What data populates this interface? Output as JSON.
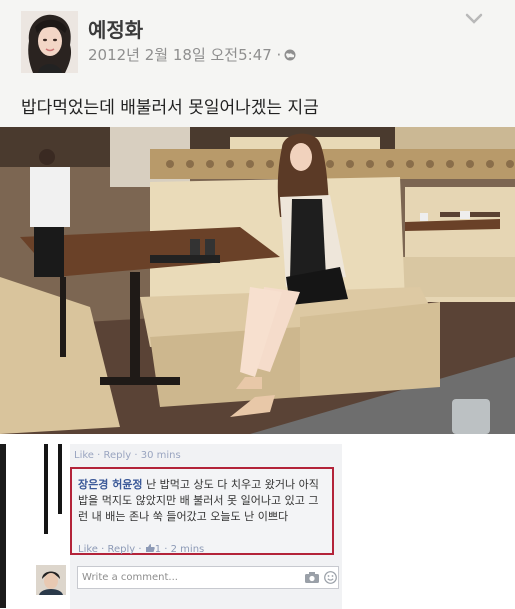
{
  "post": {
    "author": "예정화",
    "timestamp": "2012년 2월 18일 오전5:47 ·",
    "privacy_icon": "globe-icon",
    "menu_icon": "chevron-down-icon",
    "text": "밥다먹었는데 배불러서 못일어나겠는 지금"
  },
  "photo": {
    "description_icon": "photo"
  },
  "comments": {
    "prev_actions": "Like · Reply · 30 mins",
    "comment": {
      "name": "장은경 허윤정",
      "text": "난 밥먹고 상도 다 치우고 왔거나 아직 밥을 먹지도 않았지만 배 불러서 못 일어나고 있고 그런 내 배는 존나 쑥 들어갔고 오늘도 난 이쁘다",
      "actions": "Like · Reply · ",
      "likes": "1",
      "time": " · 2 mins"
    },
    "write_placeholder": "Write a comment..."
  },
  "colors": {
    "highlight_border": "#b32339",
    "link": "#3b5998"
  }
}
